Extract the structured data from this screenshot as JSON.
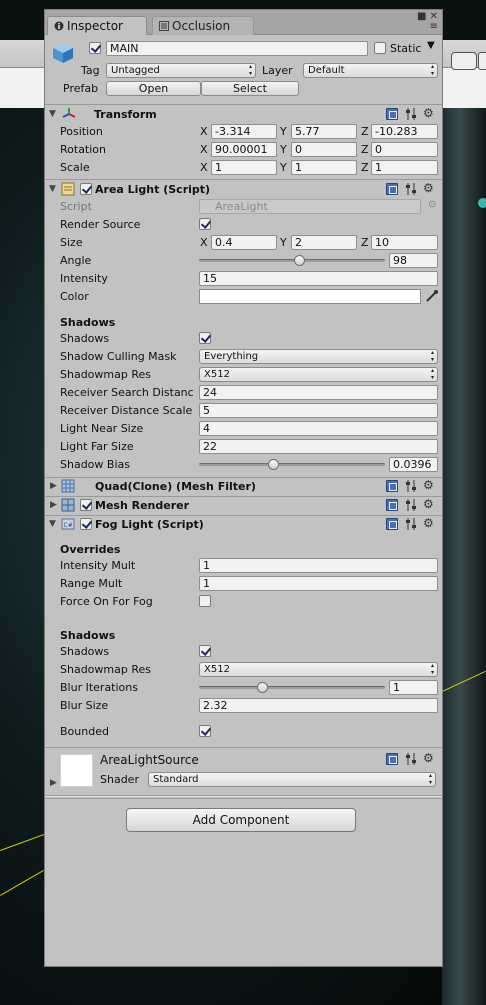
{
  "tabs": [
    {
      "label": "Inspector",
      "icon": "info-icon"
    },
    {
      "label": "Occlusion",
      "icon": "occlusion-icon"
    }
  ],
  "object": {
    "enabled": true,
    "name": "MAIN",
    "static_label": "Static",
    "static_checked": false,
    "tag_label": "Tag",
    "tag_value": "Untagged",
    "layer_label": "Layer",
    "layer_value": "Default",
    "prefab_label": "Prefab",
    "prefab_open": "Open",
    "prefab_select": "Select"
  },
  "transform": {
    "title": "Transform",
    "rows": [
      {
        "label": "Position",
        "x": "-3.314",
        "y": "5.77",
        "z": "-10.283"
      },
      {
        "label": "Rotation",
        "x": "90.00001",
        "y": "0",
        "z": "0"
      },
      {
        "label": "Scale",
        "x": "1",
        "y": "1",
        "z": "1"
      }
    ]
  },
  "area_light": {
    "title": "Area Light (Script)",
    "enabled": true,
    "script_label": "Script",
    "script_value": "AreaLight",
    "render_source_label": "Render Source",
    "render_source": true,
    "size_label": "Size",
    "size": {
      "x": "0.4",
      "y": "2",
      "z": "10"
    },
    "angle_label": "Angle",
    "angle_value": "98",
    "angle_fraction": 0.54,
    "intensity_label": "Intensity",
    "intensity_value": "15",
    "color_label": "Color",
    "color_value": "#ffffff",
    "shadows_header": "Shadows",
    "shadows_label": "Shadows",
    "shadows": true,
    "culling_label": "Shadow Culling Mask",
    "culling_value": "Everything",
    "shadowmap_label": "Shadowmap Res",
    "shadowmap_value": "X512",
    "rsd_label": "Receiver Search Distanc",
    "rsd_value": "24",
    "rds_label": "Receiver Distance Scale",
    "rds_value": "5",
    "near_label": "Light Near Size",
    "near_value": "4",
    "far_label": "Light Far Size",
    "far_value": "22",
    "bias_label": "Shadow Bias",
    "bias_value": "0.0396",
    "bias_fraction": 0.4
  },
  "mesh_filter": {
    "title": "Quad(Clone) (Mesh Filter)"
  },
  "mesh_renderer": {
    "title": "Mesh Renderer",
    "enabled": true
  },
  "fog_light": {
    "title": "Fog Light (Script)",
    "enabled": true,
    "overrides_header": "Overrides",
    "intensity_label": "Intensity Mult",
    "intensity_value": "1",
    "range_label": "Range Mult",
    "range_value": "1",
    "force_label": "Force On For Fog",
    "force_on": false,
    "shadows_header": "Shadows",
    "shadows_label": "Shadows",
    "shadows": true,
    "shadowmap_label": "Shadowmap Res",
    "shadowmap_value": "X512",
    "blur_iter_label": "Blur Iterations",
    "blur_iter_value": "1",
    "blur_iter_fraction": 0.34,
    "blur_size_label": "Blur Size",
    "blur_size_value": "2.32",
    "bounded_label": "Bounded",
    "bounded": true
  },
  "material": {
    "name": "AreaLightSource",
    "shader_label": "Shader",
    "shader_value": "Standard"
  },
  "add_component": "Add Component",
  "colors": {
    "panel": "#c2c2c2",
    "accent": "#4a6fb0"
  }
}
